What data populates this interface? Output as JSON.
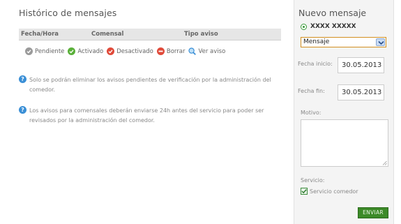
{
  "history": {
    "title": "Histórico de mensajes",
    "columns": [
      "Fecha/Hora",
      "Comensal",
      "Tipo aviso"
    ],
    "legend": [
      {
        "label": "Pendiente",
        "icon": "pending-icon",
        "color": "#9a9a9a"
      },
      {
        "label": "Activado",
        "icon": "check-icon",
        "color": "#5ab03a"
      },
      {
        "label": "Desactivado",
        "icon": "x-icon",
        "color": "#e04a3a"
      },
      {
        "label": "Borrar",
        "icon": "minus-icon",
        "color": "#e04a3a"
      },
      {
        "label": "Ver aviso",
        "icon": "magnifier-icon",
        "color": "#3a8fd6"
      }
    ],
    "notes": [
      "Solo se podrán eliminar los avisos pendientes de verificación por la administración del comedor.",
      "Los avisos para comensales deberán enviarse 24h antes del servicio para poder ser revisados por la administración del comedor."
    ],
    "info_icon_text": "?"
  },
  "form": {
    "title": "Nuevo mensaje",
    "recipient": "XXXX XXXXX",
    "message_type": "Mensaje",
    "start_label": "Fecha inicio:",
    "start_value": "30.05.2013",
    "end_label": "Fecha fin:",
    "end_value": "30.05.2013",
    "reason_label": "Motivo:",
    "reason_value": "",
    "service_label": "Servicio:",
    "service_option": "Servicio comedor",
    "service_checked": true,
    "send_label": "ENVIAR"
  },
  "colors": {
    "accent_green": "#3c8a28",
    "info_blue": "#3a8fd6",
    "panel_bg": "#f4f4f4",
    "header_bg": "#e6e6e6"
  }
}
